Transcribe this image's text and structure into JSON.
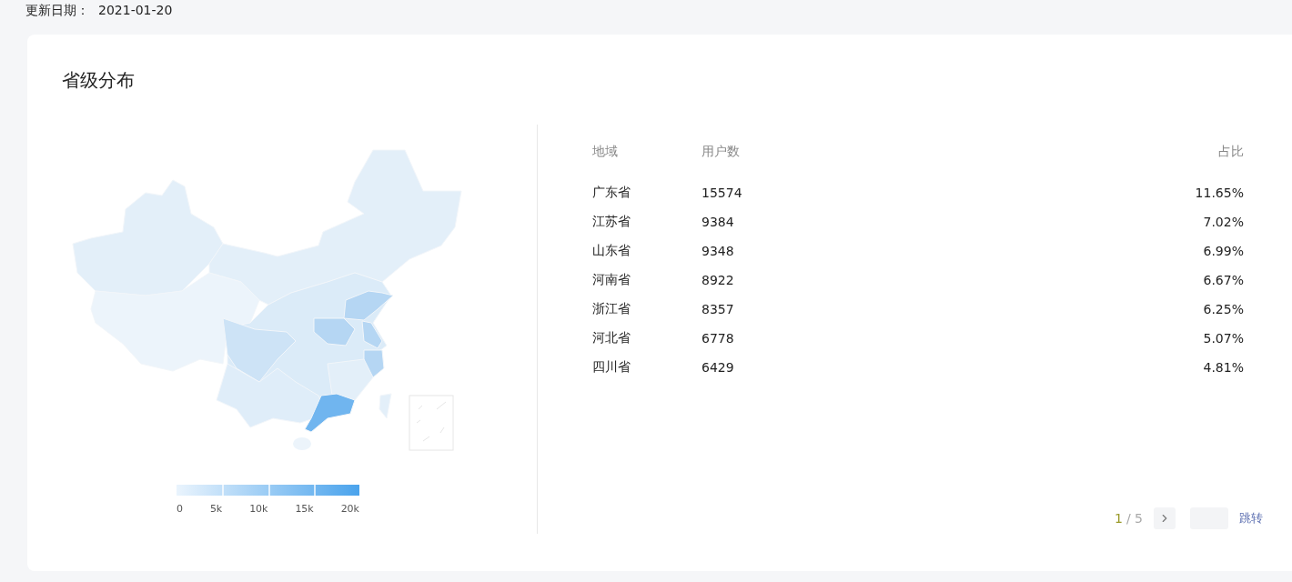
{
  "update": {
    "label": "更新日期：",
    "value": "2021-01-20"
  },
  "card": {
    "title": "省级分布"
  },
  "legend": {
    "ticks": [
      "0",
      "5k",
      "10k",
      "15k",
      "20k"
    ]
  },
  "table": {
    "columns": [
      "地域",
      "用户数",
      "占比"
    ],
    "rows": [
      {
        "region": "广东省",
        "users": "15574",
        "share": "11.65%"
      },
      {
        "region": "江苏省",
        "users": "9384",
        "share": "7.02%"
      },
      {
        "region": "山东省",
        "users": "9348",
        "share": "6.99%"
      },
      {
        "region": "河南省",
        "users": "8922",
        "share": "6.67%"
      },
      {
        "region": "浙江省",
        "users": "8357",
        "share": "6.25%"
      },
      {
        "region": "河北省",
        "users": "6778",
        "share": "5.07%"
      },
      {
        "region": "四川省",
        "users": "6429",
        "share": "4.81%"
      }
    ]
  },
  "pagination": {
    "current": "1",
    "total": "/ 5",
    "jump": "跳转"
  }
}
